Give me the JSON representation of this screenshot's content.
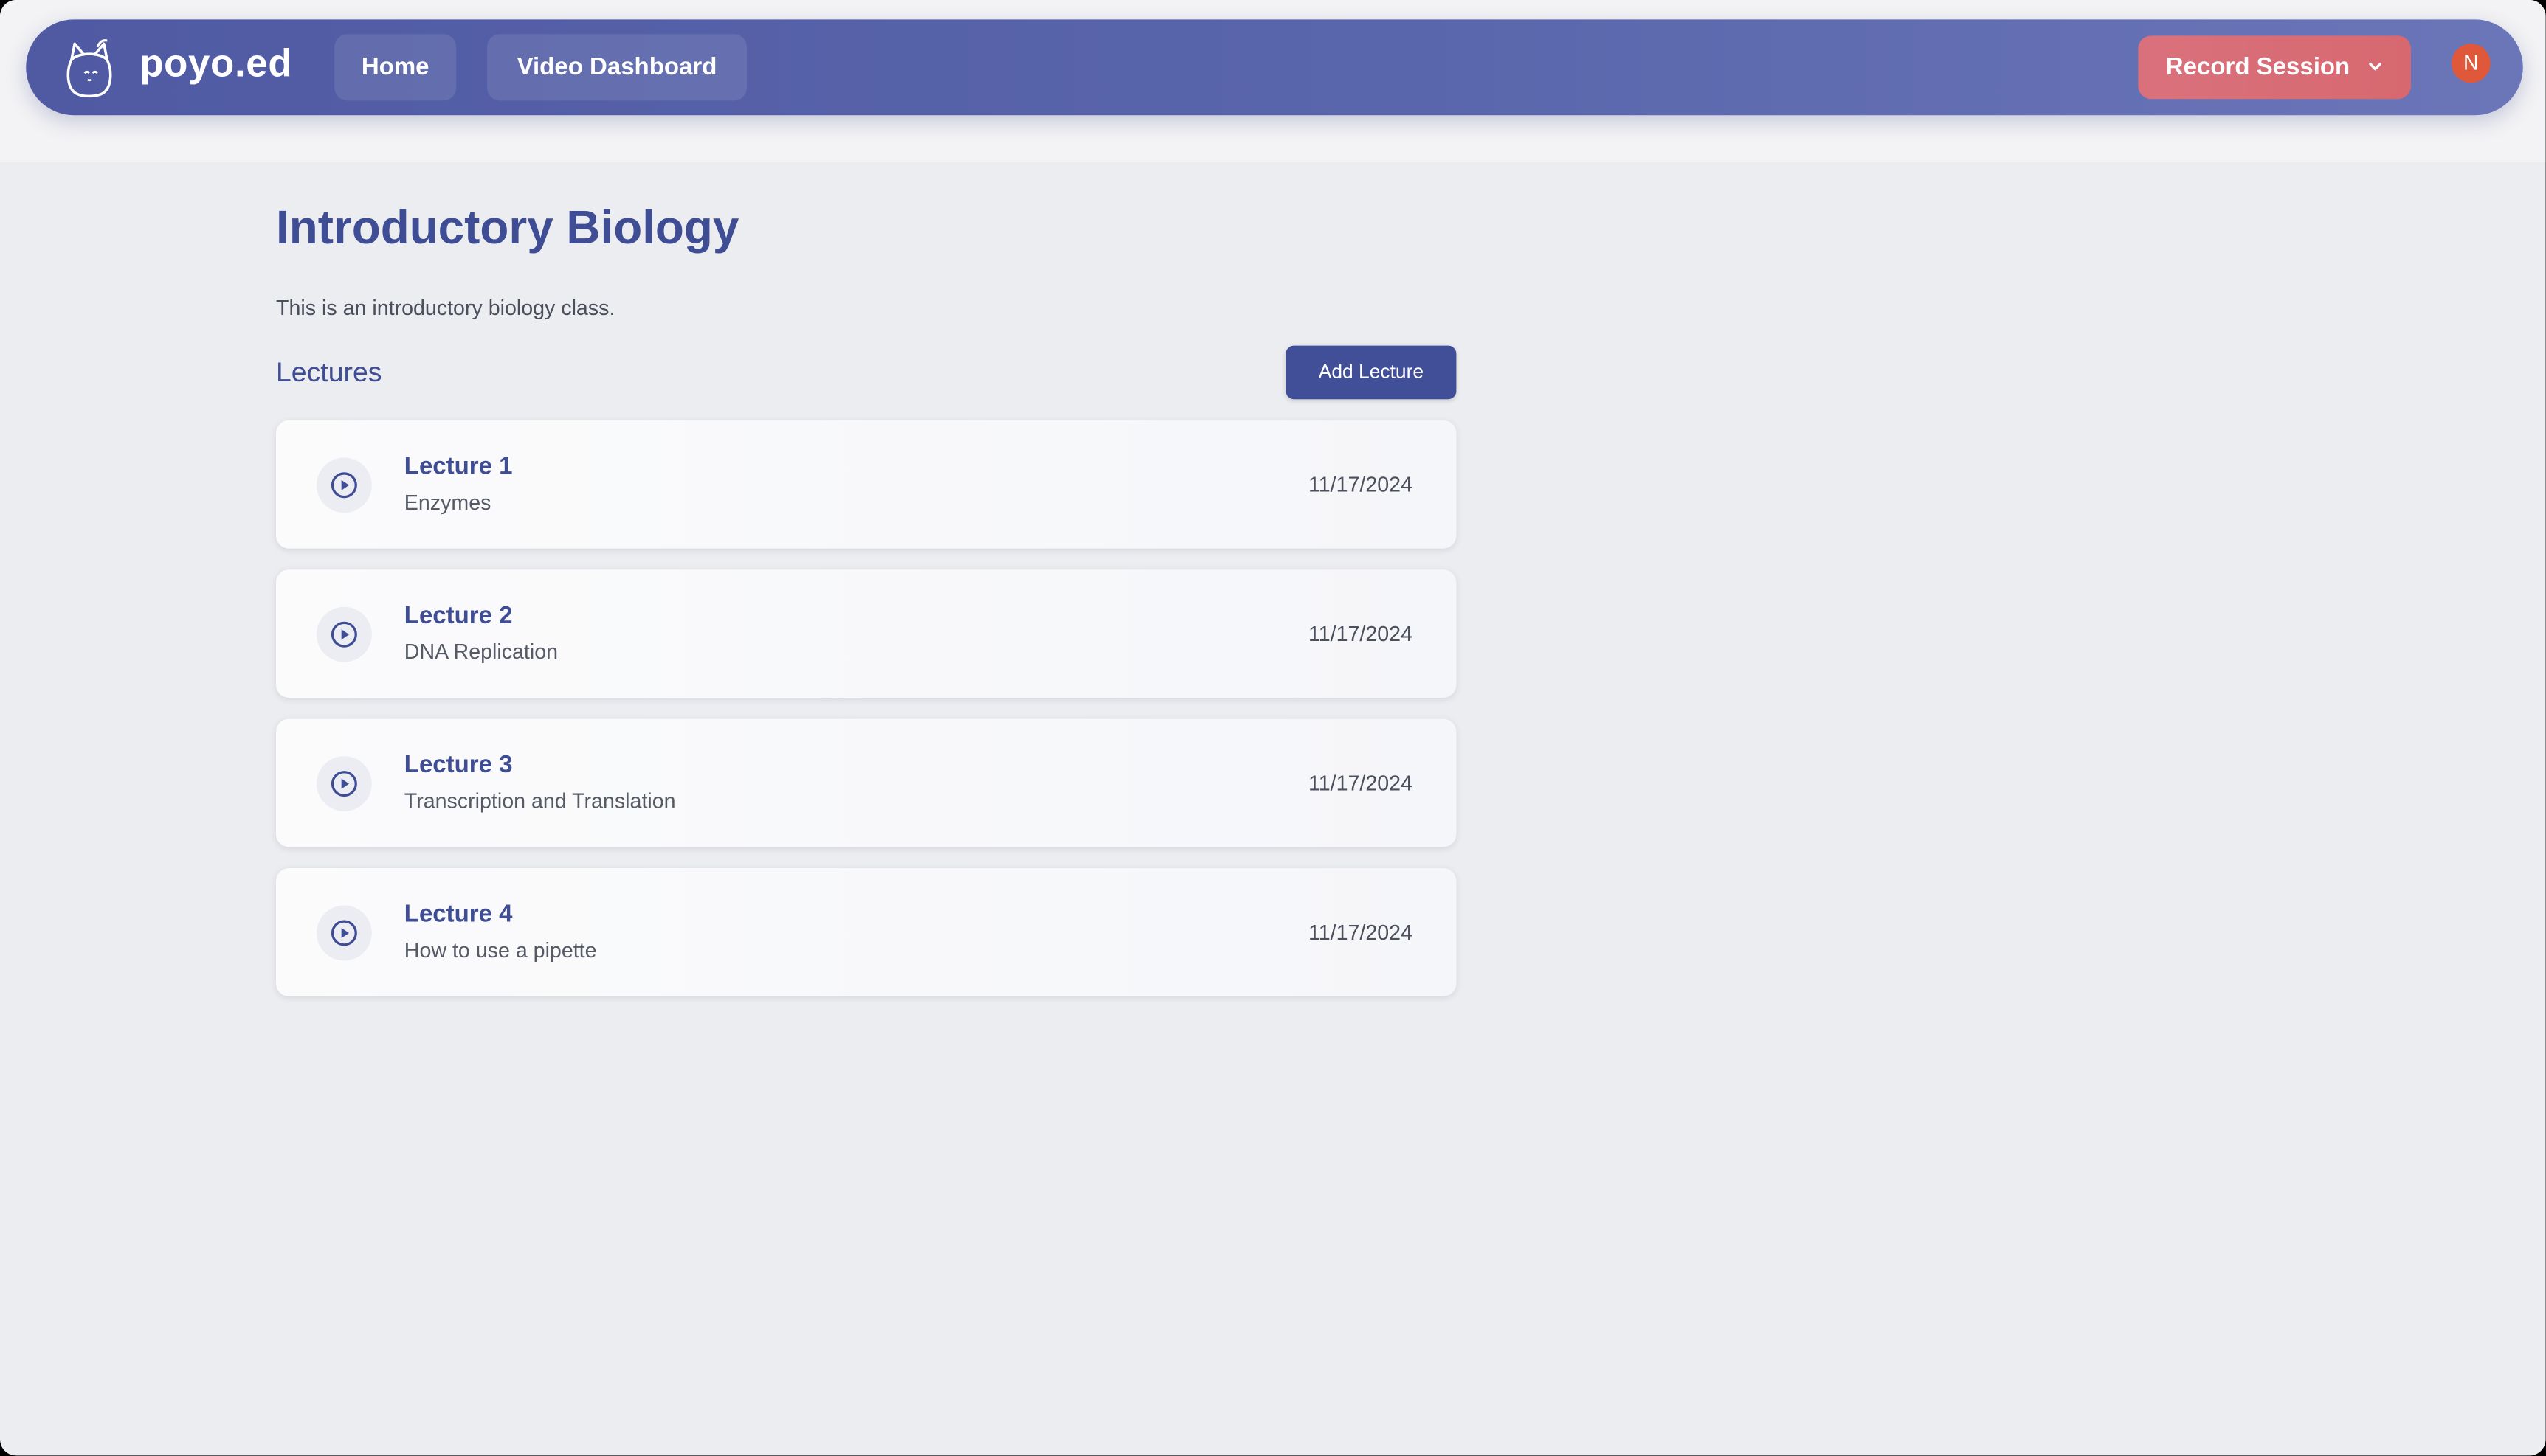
{
  "header": {
    "brand": "poyo.ed",
    "nav": [
      "Home",
      "Video Dashboard"
    ],
    "record_button": "Record Session",
    "avatar_initial": "N"
  },
  "course": {
    "title": "Introductory Biology",
    "description": "This is an introductory biology class.",
    "lectures_heading": "Lectures",
    "add_lecture_button": "Add Lecture"
  },
  "lectures": [
    {
      "title": "Lecture 1",
      "topic": "Enzymes",
      "date": "11/17/2024"
    },
    {
      "title": "Lecture 2",
      "topic": "DNA Replication",
      "date": "11/17/2024"
    },
    {
      "title": "Lecture 3",
      "topic": "Transcription and Translation",
      "date": "11/17/2024"
    },
    {
      "title": "Lecture 4",
      "topic": "How to use a pipette",
      "date": "11/17/2024"
    }
  ],
  "icons": {
    "logo": "cat-logo-icon",
    "record_menu": "chevron-down-icon",
    "lecture": "play-circle-icon"
  },
  "colors": {
    "navbar": "#5763a8",
    "accent": "#3f4d95",
    "record": "#d9717c",
    "avatar": "#e0583a",
    "background": "#ecedf0"
  }
}
